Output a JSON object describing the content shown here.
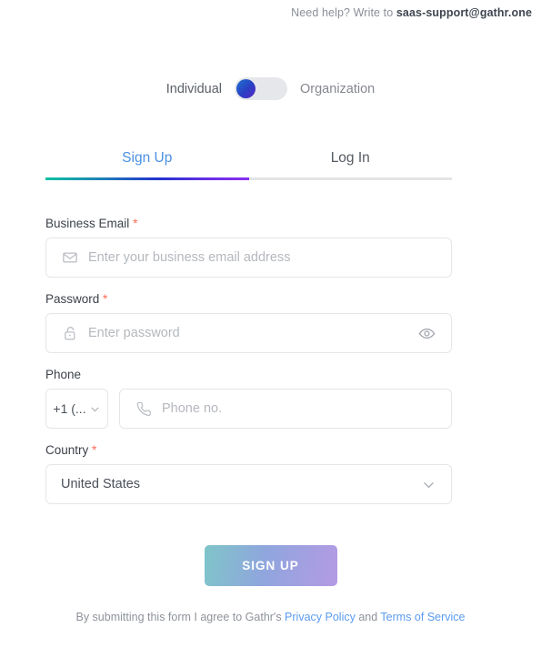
{
  "header": {
    "help_prefix": "Need help? Write to ",
    "support_email": "saas-support@gathr.one"
  },
  "account_type_toggle": {
    "left_label": "Individual",
    "right_label": "Organization",
    "selected": "Individual",
    "knob_gradient_start": "#1f72d0",
    "knob_gradient_end": "#5b24c4",
    "track_color": "#e6e7ea"
  },
  "tabs": {
    "items": [
      {
        "label": "Sign Up",
        "active": true
      },
      {
        "label": "Log In",
        "active": false
      }
    ],
    "active_color": "#4a90e2",
    "inactive_color": "#555a61",
    "underline_gradient": [
      "#0ec2a0",
      "#2233cc",
      "#8b2ff0"
    ]
  },
  "form": {
    "email": {
      "label": "Business Email",
      "required_mark": "*",
      "placeholder": "Enter your business email address",
      "value": "",
      "icon": "envelope-icon"
    },
    "password": {
      "label": "Password",
      "required_mark": "*",
      "placeholder": "Enter password",
      "value": "",
      "icon": "lock-icon",
      "trailing_icon": "eye-icon"
    },
    "phone": {
      "label": "Phone",
      "required_mark": "",
      "country_code_value": "+1 (...",
      "placeholder": "Phone no.",
      "value": "",
      "icon": "phone-icon"
    },
    "country": {
      "label": "Country",
      "required_mark": "*",
      "value": "United States"
    }
  },
  "submit": {
    "label": "SIGN UP"
  },
  "terms": {
    "prefix": "By submitting this form I agree to Gathr's ",
    "privacy_link": "Privacy Policy",
    "conjunction": " and ",
    "terms_link": "Terms of Service",
    "link_color": "#5b9bf0"
  }
}
